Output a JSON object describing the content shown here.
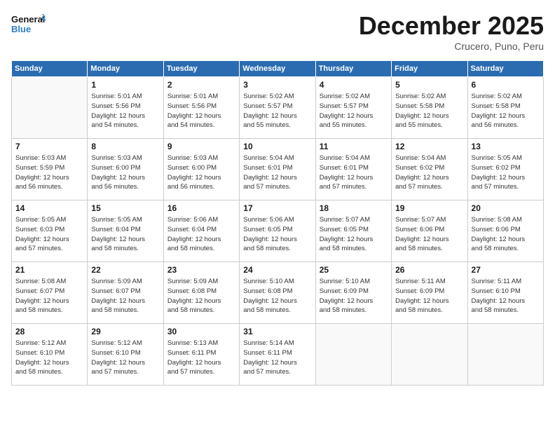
{
  "logo": {
    "line1": "General",
    "line2": "Blue"
  },
  "title": "December 2025",
  "location": "Crucero, Puno, Peru",
  "weekdays": [
    "Sunday",
    "Monday",
    "Tuesday",
    "Wednesday",
    "Thursday",
    "Friday",
    "Saturday"
  ],
  "weeks": [
    [
      {
        "day": "",
        "sunrise": "",
        "sunset": "",
        "daylight": "",
        "empty": true
      },
      {
        "day": "1",
        "sunrise": "5:01 AM",
        "sunset": "5:56 PM",
        "daylight": "12 hours and 54 minutes."
      },
      {
        "day": "2",
        "sunrise": "5:01 AM",
        "sunset": "5:56 PM",
        "daylight": "12 hours and 54 minutes."
      },
      {
        "day": "3",
        "sunrise": "5:02 AM",
        "sunset": "5:57 PM",
        "daylight": "12 hours and 55 minutes."
      },
      {
        "day": "4",
        "sunrise": "5:02 AM",
        "sunset": "5:57 PM",
        "daylight": "12 hours and 55 minutes."
      },
      {
        "day": "5",
        "sunrise": "5:02 AM",
        "sunset": "5:58 PM",
        "daylight": "12 hours and 55 minutes."
      },
      {
        "day": "6",
        "sunrise": "5:02 AM",
        "sunset": "5:58 PM",
        "daylight": "12 hours and 56 minutes."
      }
    ],
    [
      {
        "day": "7",
        "sunrise": "5:03 AM",
        "sunset": "5:59 PM",
        "daylight": "12 hours and 56 minutes."
      },
      {
        "day": "8",
        "sunrise": "5:03 AM",
        "sunset": "6:00 PM",
        "daylight": "12 hours and 56 minutes."
      },
      {
        "day": "9",
        "sunrise": "5:03 AM",
        "sunset": "6:00 PM",
        "daylight": "12 hours and 56 minutes."
      },
      {
        "day": "10",
        "sunrise": "5:04 AM",
        "sunset": "6:01 PM",
        "daylight": "12 hours and 57 minutes."
      },
      {
        "day": "11",
        "sunrise": "5:04 AM",
        "sunset": "6:01 PM",
        "daylight": "12 hours and 57 minutes."
      },
      {
        "day": "12",
        "sunrise": "5:04 AM",
        "sunset": "6:02 PM",
        "daylight": "12 hours and 57 minutes."
      },
      {
        "day": "13",
        "sunrise": "5:05 AM",
        "sunset": "6:02 PM",
        "daylight": "12 hours and 57 minutes."
      }
    ],
    [
      {
        "day": "14",
        "sunrise": "5:05 AM",
        "sunset": "6:03 PM",
        "daylight": "12 hours and 57 minutes."
      },
      {
        "day": "15",
        "sunrise": "5:05 AM",
        "sunset": "6:04 PM",
        "daylight": "12 hours and 58 minutes."
      },
      {
        "day": "16",
        "sunrise": "5:06 AM",
        "sunset": "6:04 PM",
        "daylight": "12 hours and 58 minutes."
      },
      {
        "day": "17",
        "sunrise": "5:06 AM",
        "sunset": "6:05 PM",
        "daylight": "12 hours and 58 minutes."
      },
      {
        "day": "18",
        "sunrise": "5:07 AM",
        "sunset": "6:05 PM",
        "daylight": "12 hours and 58 minutes."
      },
      {
        "day": "19",
        "sunrise": "5:07 AM",
        "sunset": "6:06 PM",
        "daylight": "12 hours and 58 minutes."
      },
      {
        "day": "20",
        "sunrise": "5:08 AM",
        "sunset": "6:06 PM",
        "daylight": "12 hours and 58 minutes."
      }
    ],
    [
      {
        "day": "21",
        "sunrise": "5:08 AM",
        "sunset": "6:07 PM",
        "daylight": "12 hours and 58 minutes."
      },
      {
        "day": "22",
        "sunrise": "5:09 AM",
        "sunset": "6:07 PM",
        "daylight": "12 hours and 58 minutes."
      },
      {
        "day": "23",
        "sunrise": "5:09 AM",
        "sunset": "6:08 PM",
        "daylight": "12 hours and 58 minutes."
      },
      {
        "day": "24",
        "sunrise": "5:10 AM",
        "sunset": "6:08 PM",
        "daylight": "12 hours and 58 minutes."
      },
      {
        "day": "25",
        "sunrise": "5:10 AM",
        "sunset": "6:09 PM",
        "daylight": "12 hours and 58 minutes."
      },
      {
        "day": "26",
        "sunrise": "5:11 AM",
        "sunset": "6:09 PM",
        "daylight": "12 hours and 58 minutes."
      },
      {
        "day": "27",
        "sunrise": "5:11 AM",
        "sunset": "6:10 PM",
        "daylight": "12 hours and 58 minutes."
      }
    ],
    [
      {
        "day": "28",
        "sunrise": "5:12 AM",
        "sunset": "6:10 PM",
        "daylight": "12 hours and 58 minutes."
      },
      {
        "day": "29",
        "sunrise": "5:12 AM",
        "sunset": "6:10 PM",
        "daylight": "12 hours and 57 minutes."
      },
      {
        "day": "30",
        "sunrise": "5:13 AM",
        "sunset": "6:11 PM",
        "daylight": "12 hours and 57 minutes."
      },
      {
        "day": "31",
        "sunrise": "5:14 AM",
        "sunset": "6:11 PM",
        "daylight": "12 hours and 57 minutes."
      },
      {
        "day": "",
        "sunrise": "",
        "sunset": "",
        "daylight": "",
        "empty": true
      },
      {
        "day": "",
        "sunrise": "",
        "sunset": "",
        "daylight": "",
        "empty": true
      },
      {
        "day": "",
        "sunrise": "",
        "sunset": "",
        "daylight": "",
        "empty": true
      }
    ]
  ],
  "labels": {
    "sunrise": "Sunrise:",
    "sunset": "Sunset:",
    "daylight": "Daylight:"
  }
}
